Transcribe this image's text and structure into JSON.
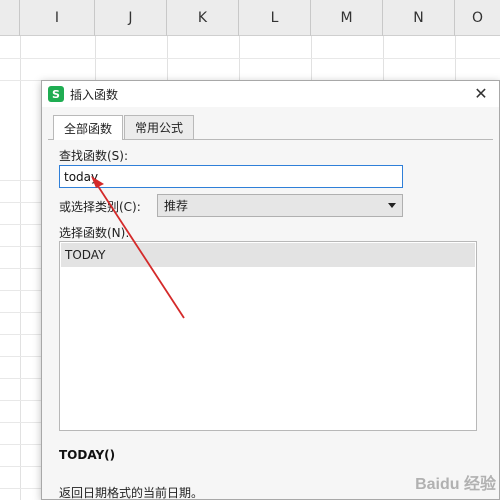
{
  "sheet": {
    "columns": [
      "I",
      "J",
      "K",
      "L",
      "M",
      "N",
      "O"
    ]
  },
  "dialog": {
    "title": "插入函数",
    "tabs": [
      {
        "label": "全部函数",
        "active": true
      },
      {
        "label": "常用公式",
        "active": false
      }
    ],
    "search_label": "查找函数(S):",
    "search_value": "today",
    "category_label": "或选择类别(C):",
    "category_selected": "推荐",
    "function_list_label": "选择函数(N):",
    "functions": [
      "TODAY"
    ],
    "selected_function_signature": "TODAY()",
    "selected_function_description": "返回日期格式的当前日期。"
  },
  "icons": {
    "app": "wps-spreadsheet-icon",
    "close": "close-icon",
    "dropdown": "chevron-down-icon"
  },
  "colors": {
    "app_icon": "#1fad52",
    "input_focus_border": "#2f7fd8",
    "annotation_arrow": "#d42a2a"
  },
  "watermark": "Baidu 经验"
}
